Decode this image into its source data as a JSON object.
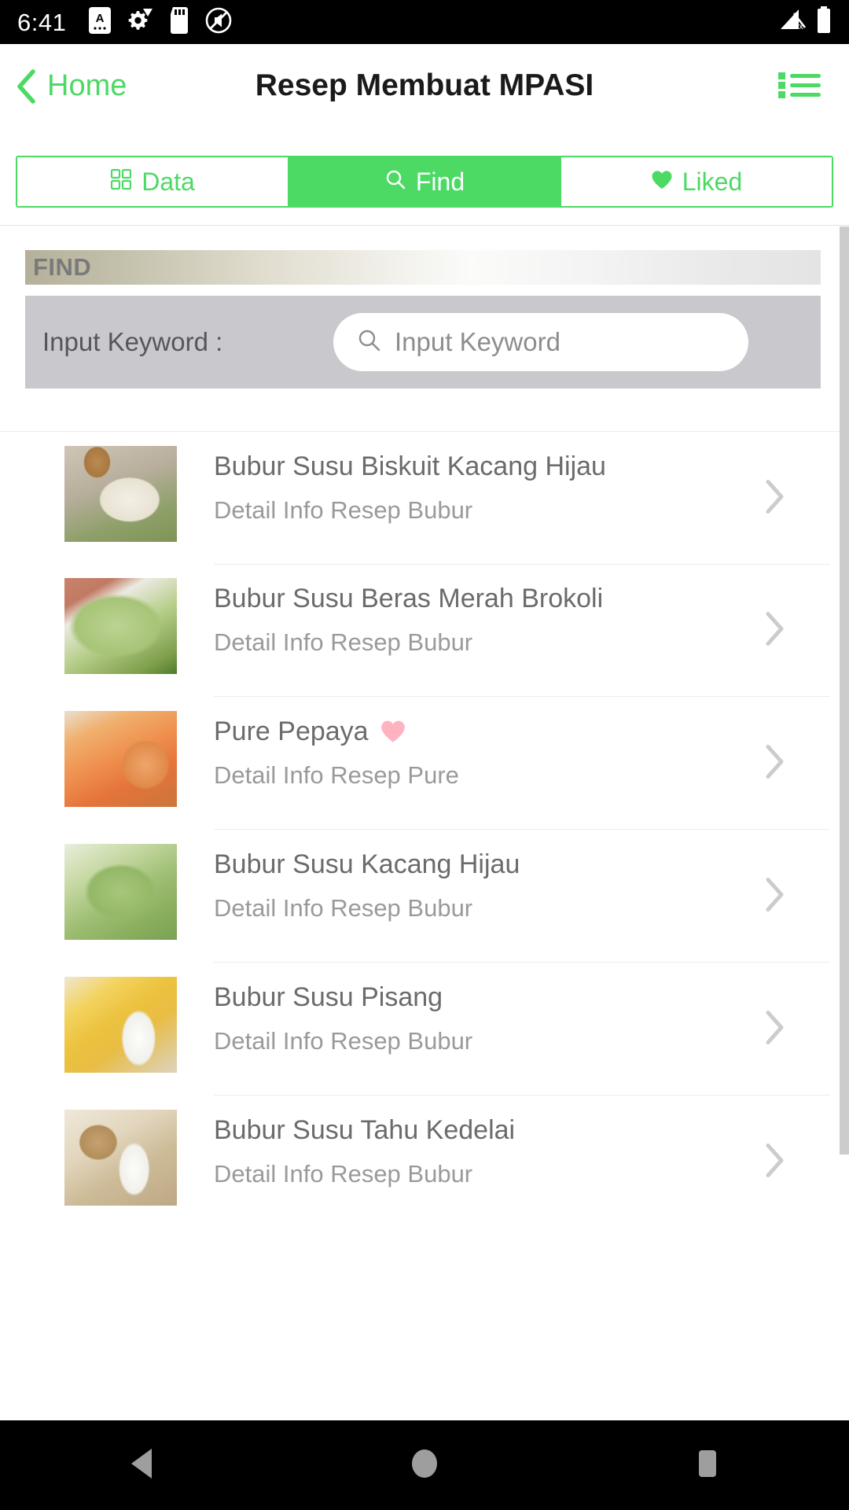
{
  "statusbar": {
    "clock": "6:41",
    "icons_left": [
      "app-badge-a-icon",
      "settings-sync-icon",
      "sd-card-icon",
      "no-sound-icon"
    ],
    "icons_right": [
      "signal-off-icon",
      "battery-full-icon"
    ]
  },
  "header": {
    "back_label": "Home",
    "title": "Resep Membuat MPASI",
    "menu_icon": "list-menu-icon",
    "accent": "#4CD964"
  },
  "tabs": [
    {
      "label": "Data",
      "icon": "grid-icon",
      "active": false
    },
    {
      "label": "Find",
      "icon": "search-icon",
      "active": true
    },
    {
      "label": "Liked",
      "icon": "heart-icon",
      "active": false
    }
  ],
  "find_section": {
    "heading": "FIND",
    "keyword_label": "Input Keyword :",
    "keyword_value": "",
    "keyword_placeholder": "Input Keyword",
    "search_icon": "search-icon"
  },
  "recipes": [
    {
      "title": "Bubur Susu Biskuit Kacang Hijau",
      "subtitle": "Detail Info Resep Bubur",
      "liked": false,
      "thumb_class": "th1",
      "thumb_alt": "bowl-of-porridge-with-mung-beans"
    },
    {
      "title": "Bubur Susu Beras Merah Brokoli",
      "subtitle": "Detail Info Resep Bubur",
      "liked": false,
      "thumb_class": "th2",
      "thumb_alt": "green-broccoli-puree-in-white-bowl"
    },
    {
      "title": "Pure Pepaya",
      "subtitle": "Detail Info Resep Pure",
      "liked": true,
      "thumb_class": "th3",
      "thumb_alt": "papaya-juice-and-halved-papaya"
    },
    {
      "title": "Bubur Susu Kacang Hijau",
      "subtitle": "Detail Info Resep Bubur",
      "liked": false,
      "thumb_class": "th4",
      "thumb_alt": "green-mung-bean-porridge-swirl"
    },
    {
      "title": "Bubur Susu Pisang",
      "subtitle": "Detail Info Resep Bubur",
      "liked": false,
      "thumb_class": "th5",
      "thumb_alt": "bananas-with-glass-of-milk"
    },
    {
      "title": "Bubur Susu Tahu Kedelai",
      "subtitle": "Detail Info Resep Bubur",
      "liked": false,
      "thumb_class": "th6",
      "thumb_alt": "tofu-cubes-with-glass-of-soy-milk"
    }
  ],
  "colors": {
    "accent_green": "#4CD964",
    "heart_pink": "#FFB3C1",
    "title_gray": "#6B6B6B",
    "subtitle_gray": "#9A9A9A",
    "chevron_gray": "#CCCCCC",
    "panel_gray": "#C9C9CD"
  },
  "navbar": {
    "back_icon": "triangle-back-icon",
    "home_icon": "circle-home-icon",
    "recents_icon": "square-recents-icon"
  }
}
